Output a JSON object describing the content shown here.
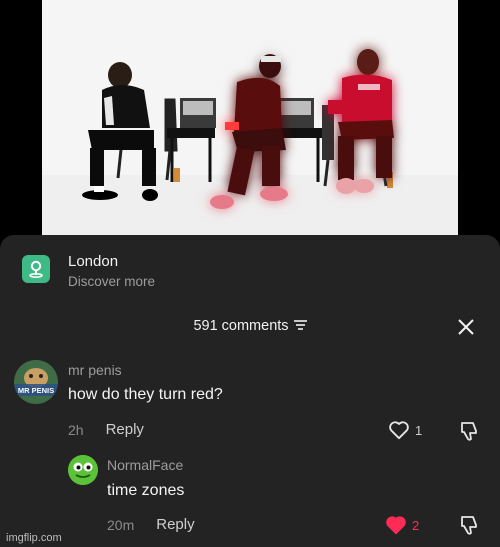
{
  "location": {
    "title": "London",
    "subtitle": "Discover more",
    "icon": "map-pin-icon",
    "icon_color": "#3dba86"
  },
  "comments_header": {
    "count_label": "591 comments",
    "sort_icon": "sort-icon",
    "close_icon": "close-icon"
  },
  "comments": [
    {
      "username": "mr penis",
      "avatar_label": "MR PENIS",
      "text": "how do they turn red?",
      "time": "2h",
      "reply_label": "Reply",
      "likes": "1",
      "liked": false
    },
    {
      "username": "NormalFace",
      "text": "time zones",
      "time": "20m",
      "reply_label": "Reply",
      "likes": "2",
      "liked": true
    }
  ],
  "colors": {
    "sheet_bg": "#232323",
    "like_active": "#fe2c55",
    "glow": "#ff2020"
  },
  "watermark": "imgflip.com"
}
